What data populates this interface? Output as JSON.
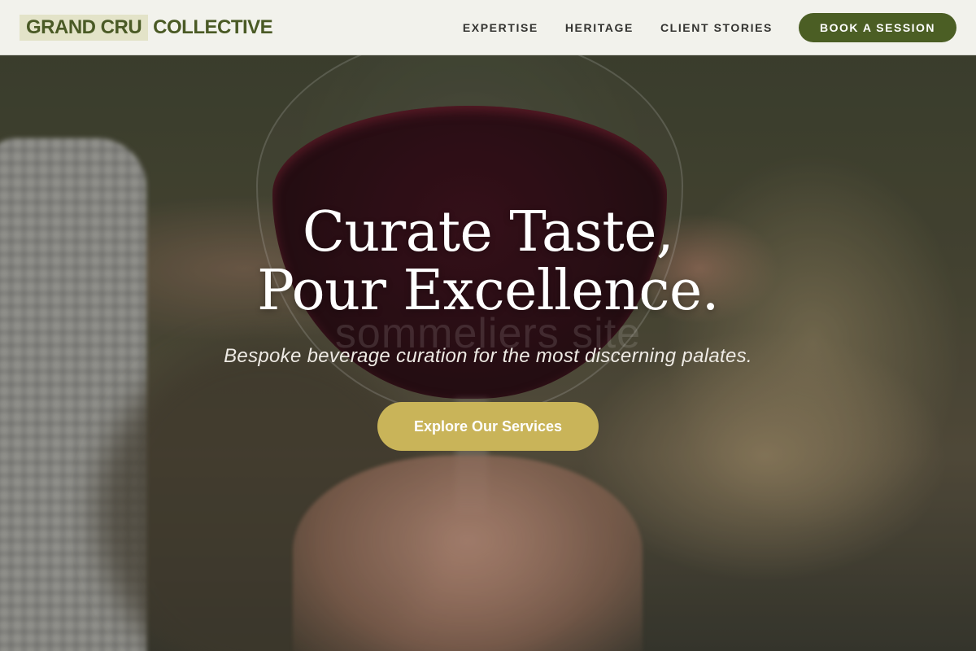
{
  "header": {
    "logo_part1": "GRAND CRU",
    "logo_part2": "COLLECTIVE",
    "nav": [
      "EXPERTISE",
      "HERITAGE",
      "CLIENT STORIES"
    ],
    "cta_label": "BOOK A SESSION"
  },
  "hero": {
    "headline_line1": "Curate Taste,",
    "headline_line2": "Pour Excellence.",
    "watermark": "sommeliers site",
    "tagline": "Bespoke beverage curation for the most discerning palates.",
    "cta_label": "Explore Our Services"
  },
  "colors": {
    "brand_green": "#4b5e24",
    "accent_gold": "#c9b459",
    "header_bg": "#f2f2ec"
  }
}
